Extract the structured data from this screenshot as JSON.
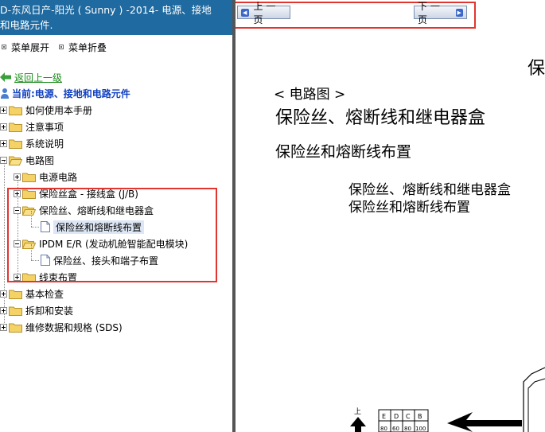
{
  "window": {
    "title_line1": "D-东风日产-阳光 ( Sunny ) -2014- 电源、接地",
    "title_line2": "和电路元件."
  },
  "menu": {
    "expand_label": "菜单展开",
    "collapse_label": "菜单折叠"
  },
  "nav": {
    "back_label": "返回上一级",
    "current_label": "当前:电源、接地和电路元件"
  },
  "tree": {
    "items": [
      {
        "label": "如何使用本手册",
        "state": "collapsed"
      },
      {
        "label": "注意事项",
        "state": "collapsed"
      },
      {
        "label": "系统说明",
        "state": "collapsed"
      },
      {
        "label": "电路图",
        "state": "expanded"
      },
      {
        "label": "电源电路",
        "state": "collapsed"
      },
      {
        "label": "保险丝盒 - 接线盒 (J/B)",
        "state": "collapsed"
      },
      {
        "label": "保险丝、熔断线和继电器盒",
        "state": "expanded"
      },
      {
        "label": "保险丝和熔断线布置",
        "state": "selected"
      },
      {
        "label": "IPDM E/R (发动机舱智能配电模块)",
        "state": "expanded"
      },
      {
        "label": "保险丝、接头和端子布置",
        "state": "leaf"
      },
      {
        "label": "线束布置",
        "state": "collapsed"
      },
      {
        "label": "基本检查",
        "state": "collapsed"
      },
      {
        "label": "拆卸和安装",
        "state": "collapsed"
      },
      {
        "label": "维修数据和规格 (SDS)",
        "state": "collapsed"
      }
    ]
  },
  "pager": {
    "prev_label": "上 一 页",
    "next_label": "下 一 页"
  },
  "document": {
    "top_title": "保",
    "section": "< 电路图 >",
    "heading": "保险丝、熔断线和继电器盒",
    "subheading": "保险丝和熔断线布置",
    "line1": "保险丝、熔断线和继电器盒",
    "line2": "保险丝和熔断线布置",
    "diagram": {
      "up_label": "上",
      "columns": [
        "E",
        "D",
        "C",
        "B"
      ],
      "values": [
        "80",
        "60",
        "80",
        "100"
      ]
    }
  },
  "colors": {
    "title_bar": "#1f6aa0",
    "highlight_box": "#e2352f",
    "back_link": "#1a8a1a",
    "current_link": "#1040c0"
  }
}
